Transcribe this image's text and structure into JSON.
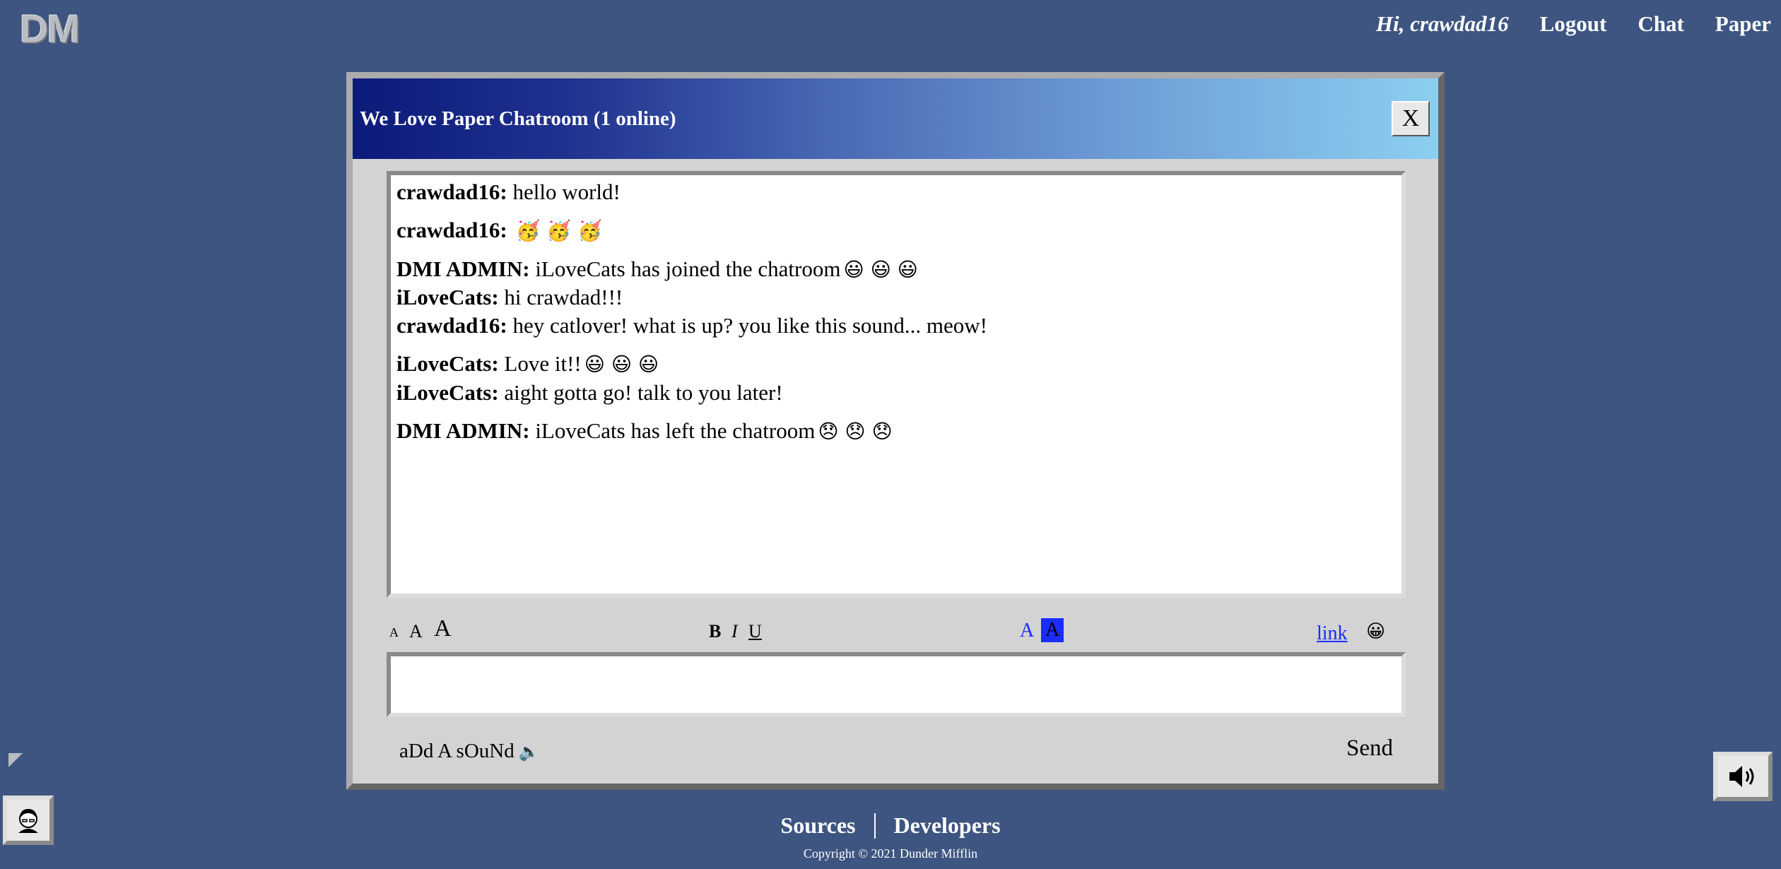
{
  "logo": "DM",
  "nav": {
    "greeting": "Hi, crawdad16",
    "logout": "Logout",
    "chat": "Chat",
    "paper": "Paper"
  },
  "chat": {
    "title": "We Love Paper Chatroom (1 online)",
    "close": "X",
    "messages": [
      {
        "user": "crawdad16:",
        "text": "hello world!",
        "emoji": ""
      },
      {
        "user": "crawdad16:",
        "text": "",
        "emoji": "🥳 🥳 🥳"
      },
      {
        "user": "DMI ADMIN:",
        "text": "iLoveCats has joined the chatroom",
        "emoji": "😃 😃 😃"
      },
      {
        "user": "iLoveCats:",
        "text": "hi crawdad!!!",
        "emoji": ""
      },
      {
        "user": "crawdad16:",
        "text": "hey catlover! what is up? you like this sound... meow!",
        "emoji": ""
      },
      {
        "user": "iLoveCats:",
        "text": "Love it!!",
        "emoji": "😃 😃 😃"
      },
      {
        "user": "iLoveCats:",
        "text": "aight gotta go! talk to you later!",
        "emoji": ""
      },
      {
        "user": "DMI ADMIN:",
        "text": "iLoveCats has left the chatroom",
        "emoji": "😞 😞 😞"
      }
    ],
    "toolbar": {
      "size_small": "A",
      "size_medium": "A",
      "size_large": "A",
      "bold": "B",
      "italic": "I",
      "underline": "U",
      "text_color": "A",
      "highlight_color": "A",
      "link": "link",
      "emoji": "😀"
    },
    "compose_value": "",
    "add_sound": "aDd A sOuNd",
    "add_sound_icon": "🔈",
    "send": "Send"
  },
  "footer": {
    "sources": "Sources",
    "developers": "Developers",
    "copyright": "Copyright © 2021 Dunder Mifflin"
  },
  "colors": {
    "background": "#3d5580",
    "window": "#d3d3d3",
    "accent_blue": "#1a2cff"
  }
}
